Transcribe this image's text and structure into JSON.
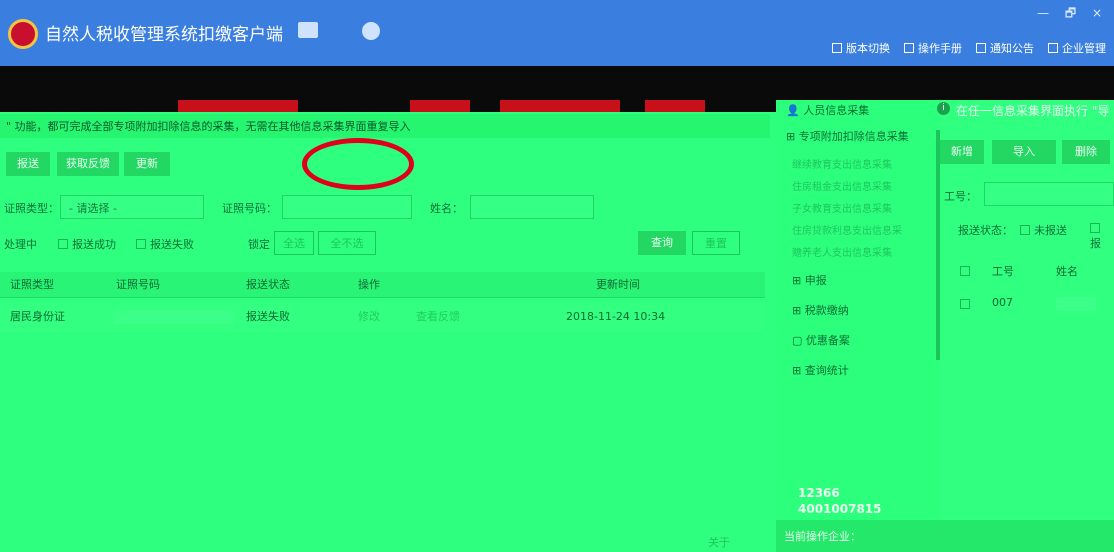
{
  "app": {
    "title": "自然人税收管理系统扣缴客户端"
  },
  "window_controls": {
    "label": "— 🗗 ×"
  },
  "top_links": [
    {
      "icon": "document-icon",
      "label": "版本切换"
    },
    {
      "icon": "document-icon",
      "label": "操作手册"
    },
    {
      "icon": "mail-icon",
      "label": "通知公告"
    },
    {
      "icon": "building-icon",
      "label": "企业管理"
    }
  ],
  "notice": "\" 功能，都可完成全部专项附加扣除信息的采集，无需在其他信息采集界面重复导入",
  "actions": {
    "submit": "报送",
    "feedback": "获取反馈",
    "update": "更新"
  },
  "filters": {
    "id_type_label": "证照类型：",
    "id_type_value": "- 请选择 -",
    "id_no_label": "证照号码：",
    "name_label": "姓名："
  },
  "status_filters": {
    "processing": "处理中",
    "success": "报送成功",
    "failed": "报送失败",
    "locked": "锁定",
    "select_all": "全选",
    "deselect_all": "全不选",
    "query": "查询",
    "reset": "重置"
  },
  "table": {
    "headers": [
      "证照类型",
      "证照号码",
      "报送状态",
      "操作",
      "更新时间"
    ],
    "rows": [
      {
        "id_type": "居民身份证",
        "status": "报送失败",
        "edit": "修改",
        "view_feedback": "查看反馈",
        "updated": "2018-11-24 10:34"
      }
    ]
  },
  "sidebar": {
    "items": [
      {
        "icon": "user-icon",
        "label": "人员信息采集"
      },
      {
        "icon": "grid-icon",
        "label": "专项附加扣除信息采集"
      }
    ],
    "sub_items": [
      "继续教育支出信息采集",
      "住房租金支出信息采集",
      "子女教育支出信息采集",
      "住房贷款利息支出信息采",
      "赡养老人支出信息采集"
    ],
    "main_items": [
      {
        "icon": "grid-icon",
        "label": "申报"
      },
      {
        "icon": "grid-icon",
        "label": "税款缴纳"
      },
      {
        "icon": "square-icon",
        "label": "优惠备案"
      },
      {
        "icon": "grid-icon",
        "label": "查询统计"
      }
    ],
    "hotline": [
      "12366",
      "4001007815"
    ],
    "current_company_label": "当前操作企业：",
    "close_label": "关于"
  },
  "right_panel": {
    "info": "在任一信息采集界面执行 \"导",
    "buttons": {
      "add": "新增",
      "import": "导入",
      "delete": "删除"
    },
    "emp_no_label": "工号：",
    "status_label": "报送状态：",
    "not_submitted": "未报送",
    "submitted_abbrev": "报",
    "grid_headers": [
      "工号",
      "姓名"
    ],
    "grid_row": {
      "emp_no": "007"
    }
  },
  "colors": {
    "accent_red": "#e0001b",
    "title_blue": "#3a7fe0"
  }
}
